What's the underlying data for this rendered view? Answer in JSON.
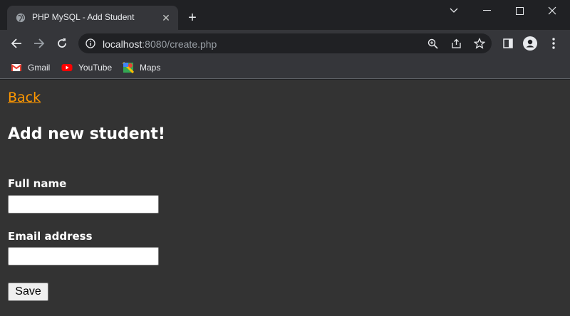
{
  "browser": {
    "tab": {
      "title": "PHP MySQL - Add Student",
      "favicon": "globe-icon"
    },
    "url": {
      "host": "localhost",
      "path": ":8080/create.php"
    },
    "bookmarks": [
      {
        "label": "Gmail",
        "icon": "gmail-icon"
      },
      {
        "label": "YouTube",
        "icon": "youtube-icon"
      },
      {
        "label": "Maps",
        "icon": "maps-icon"
      }
    ]
  },
  "page": {
    "back_link": "Back",
    "heading": "Add new student!",
    "form": {
      "full_name_label": "Full name",
      "full_name_value": "",
      "email_label": "Email address",
      "email_value": "",
      "save_label": "Save"
    }
  },
  "colors": {
    "page_bg": "#333333",
    "link": "#ff9800",
    "text": "#ffffff",
    "chrome_dark": "#202124",
    "chrome_toolbar": "#35363a"
  }
}
